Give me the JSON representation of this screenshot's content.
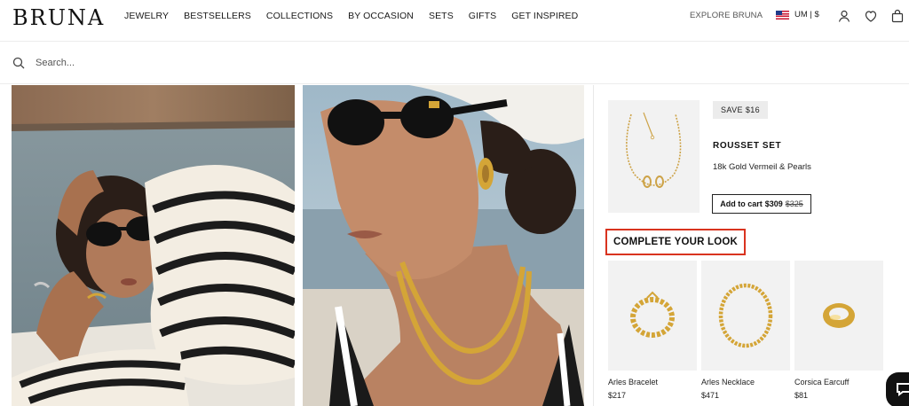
{
  "brand": {
    "logo": "BRUNA"
  },
  "nav": {
    "items": [
      "JEWELRY",
      "BESTSELLERS",
      "COLLECTIONS",
      "BY OCCASION",
      "SETS",
      "GIFTS",
      "GET INSPIRED"
    ],
    "explore": "EXPLORE BRUNA",
    "locale": "UM | $"
  },
  "header_icons": [
    "account-icon",
    "wishlist-heart-icon",
    "cart-bag-icon"
  ],
  "search": {
    "placeholder": "Search..."
  },
  "panel": {
    "set": {
      "save_badge": "SAVE $16",
      "title": "ROUSSET SET",
      "subtitle": "18k Gold Vermeil & Pearls",
      "cart_label": "Add to cart",
      "price": "$309",
      "old_price": "$325"
    },
    "look_heading": "COMPLETE YOUR LOOK",
    "products": [
      {
        "name": "Arles Bracelet",
        "price": "$217"
      },
      {
        "name": "Arles Necklace",
        "price": "$471"
      },
      {
        "name": "Corsica Earcuff",
        "price": "$81"
      }
    ]
  },
  "colors": {
    "highlight": "#d9331f",
    "gold": "#d4a537",
    "text": "#1a1a1a"
  }
}
